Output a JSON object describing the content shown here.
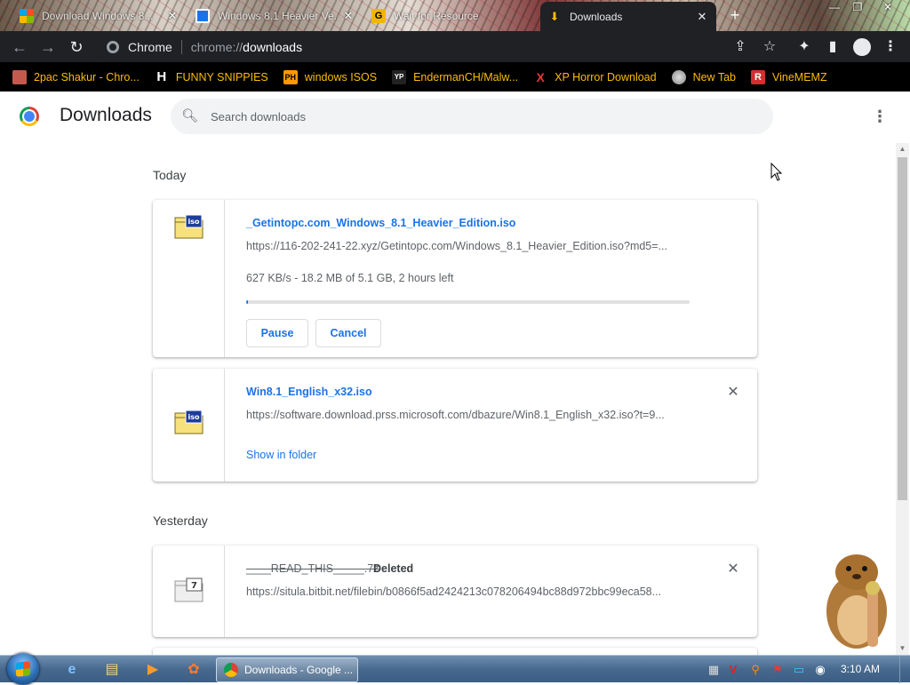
{
  "browser": {
    "tabs": [
      {
        "title": "Download Windows 8...",
        "active": false,
        "icon": "windows-icon"
      },
      {
        "title": "Windows 8.1 Heavier Ve...",
        "active": false,
        "icon": "site-icon"
      },
      {
        "title": "Wait for Resource",
        "active": false,
        "icon": "getintopc-icon"
      },
      {
        "title": "Downloads",
        "active": true,
        "icon": "download-icon"
      }
    ],
    "omnibox": {
      "site": "Chrome",
      "scheme": "chrome://",
      "path": "downloads"
    },
    "bookmarks": [
      {
        "label": "2pac Shakur - Chro...",
        "icon": "folder-icon"
      },
      {
        "label": "FUNNY SNIPPIES",
        "icon": "h-icon",
        "glyph": "H"
      },
      {
        "label": "windows ISOS",
        "icon": "ph-icon",
        "glyph": "PH"
      },
      {
        "label": "EndermanCH/Malw...",
        "icon": "yp-icon",
        "glyph": "YP"
      },
      {
        "label": "XP Horror Download",
        "icon": "x-icon",
        "glyph": "X"
      },
      {
        "label": "New Tab",
        "icon": "globe-icon"
      },
      {
        "label": "VineMEMZ",
        "icon": "r-icon",
        "glyph": "R"
      }
    ]
  },
  "downloads_page": {
    "title": "Downloads",
    "search_placeholder": "Search downloads",
    "sections": [
      {
        "label": "Today",
        "items": [
          {
            "name": "_Getintopc.com_Windows_8.1_Heavier_Edition.iso",
            "url": "https://116-202-241-22.xyz/Getintopc.com/Windows_8.1_Heavier_Edition.iso?md5=...",
            "status": "627 KB/s - 18.2 MB of 5.1 GB, 2 hours left",
            "progress": 0.0036,
            "buttons": {
              "pause": "Pause",
              "cancel": "Cancel"
            }
          },
          {
            "name": "Win8.1_English_x32.iso",
            "url": "https://software.download.prss.microsoft.com/dbazure/Win8.1_English_x32.iso?t=9...",
            "link": "Show in folder"
          }
        ]
      },
      {
        "label": "Yesterday",
        "items": [
          {
            "name": "____READ_THIS_____.7z",
            "tag": "Deleted",
            "url": "https://situla.bitbit.net/filebin/b0866f5ad2424213c078206494bc88d972bbc99eca58..."
          }
        ]
      }
    ]
  },
  "taskbar": {
    "task_title": "Downloads - Google ...",
    "clock": "3:10 AM"
  },
  "colors": {
    "accent": "#1a73e8",
    "bookmark_text": "#fbbc04",
    "toolbar_bg": "#202124"
  }
}
